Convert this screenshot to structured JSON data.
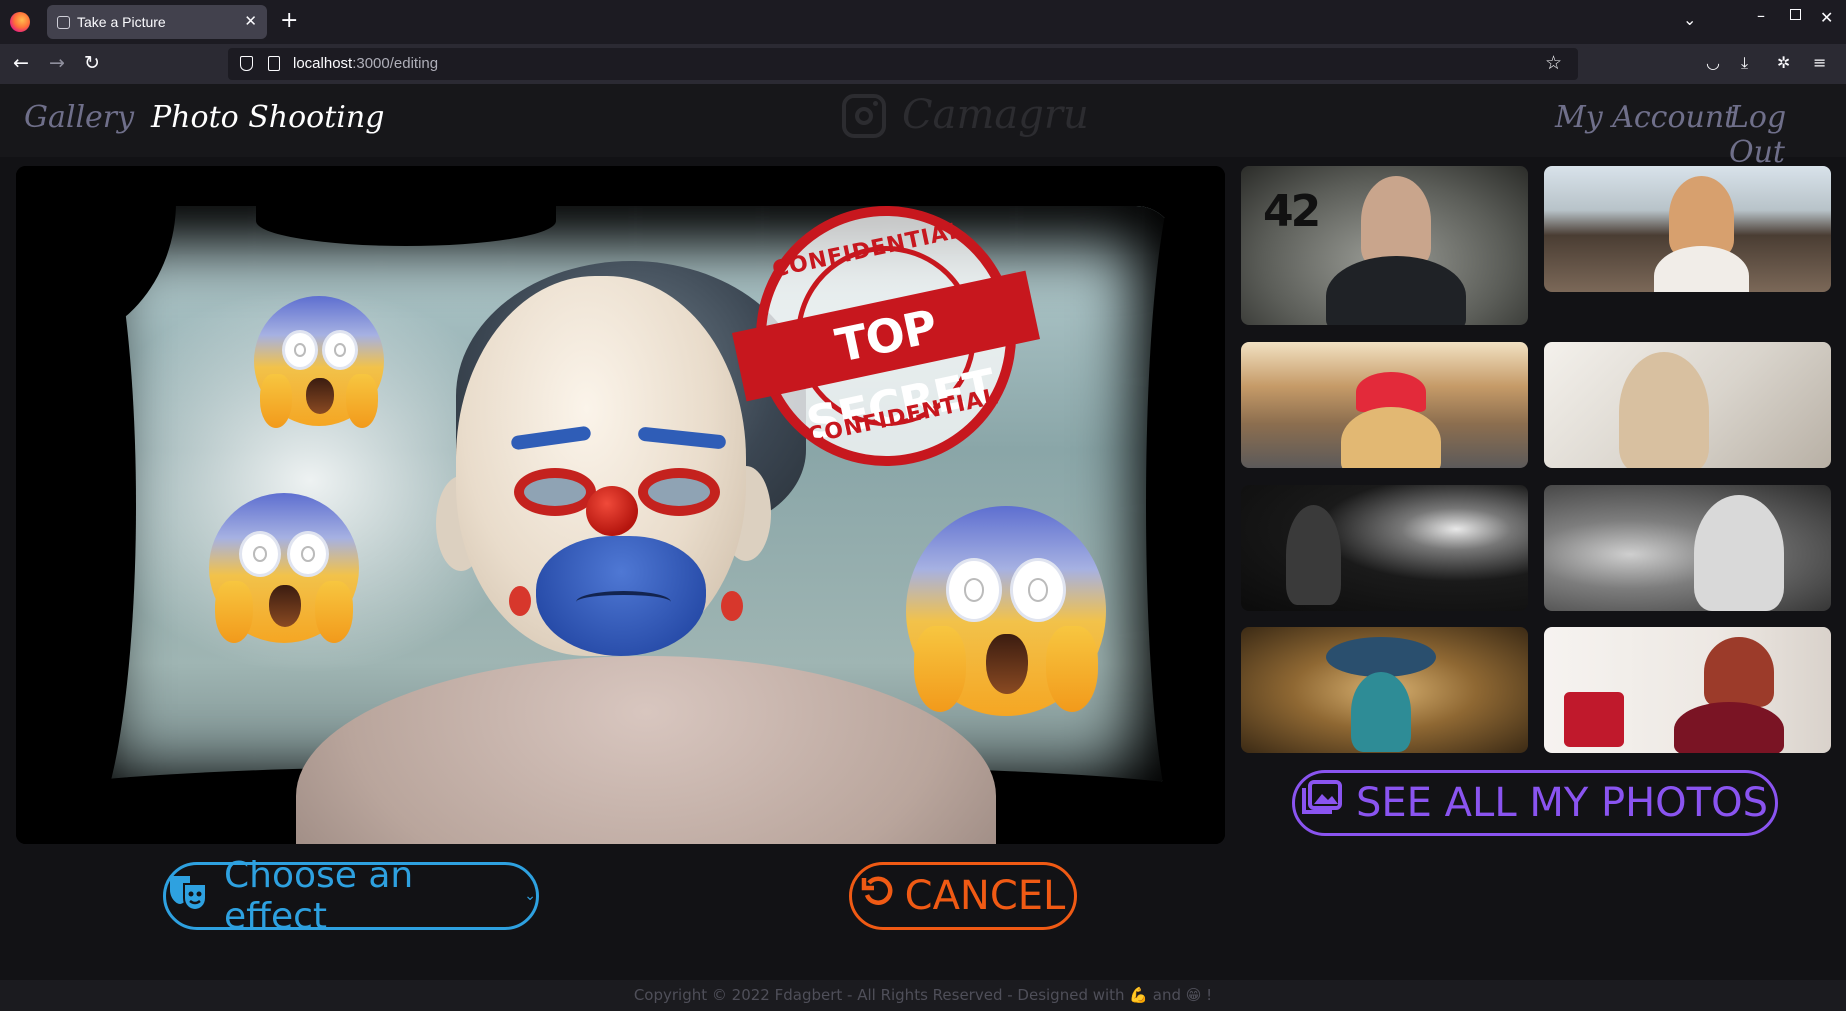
{
  "browser": {
    "tab_title": "Take a Picture",
    "new_tab_label": "+",
    "url_host": "localhost",
    "url_path": ":3000/editing"
  },
  "site": {
    "nav_left": [
      "Gallery",
      "Photo Shooting"
    ],
    "active_nav": "Photo Shooting",
    "logo_text": "Camagru",
    "nav_right": [
      "My Account",
      "Log Out"
    ]
  },
  "editor": {
    "stamp_top": "CONFIDENTIAL",
    "stamp_banner": "TOP SECRET",
    "stamp_bottom": "CONFIDENTIAL",
    "thumbnail_badge": "42"
  },
  "actions": {
    "see_all": "SEE ALL MY PHOTOS",
    "choose_effect": "Choose an effect",
    "cancel": "CANCEL"
  },
  "footer": {
    "text": "Copyright © 2022 Fdagbert - All Rights Reserved - Designed with 💪 and 😁 !"
  },
  "colors": {
    "see_all": "#8a54f0",
    "choose_effect": "#2ea1e0",
    "cancel": "#f05a14"
  }
}
